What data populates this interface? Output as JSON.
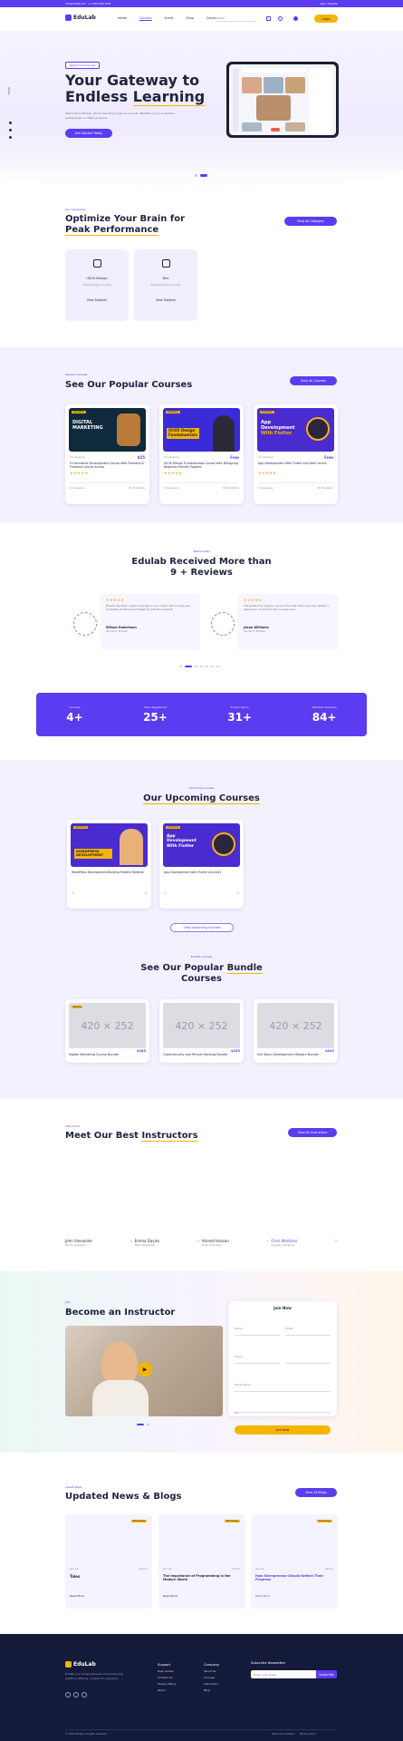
{
  "topbar": {
    "left1": "info@edulab.com",
    "left2": "+1 (555) 000-1234",
    "right": "Login / Register"
  },
  "nav": {
    "logo": "EduLab",
    "items": [
      "Home",
      "Courses",
      "Event",
      "Shop",
      "Contact"
    ],
    "search_placeholder": "Search",
    "cta": "Login"
  },
  "hero": {
    "badge": "Best Online Courses",
    "title1": "Your Gateway to",
    "title2": "Endless",
    "title3": "Learning",
    "desc": "Welcome to Edulab, where learning knows no bounds. Whether you're a student, professional, or lifelong learner.",
    "button": "Get Started Today",
    "side": [
      "Twitter",
      "Facebook",
      "Instagram"
    ]
  },
  "brain": {
    "label": "Our Categories",
    "title1": "Optimize Your Brain for",
    "title2": "Peak Performance",
    "button": "View All Category",
    "cards": [
      {
        "title": "UI/UX Design",
        "sub": "UI/UX Design courses",
        "link": "View Subjects"
      },
      {
        "title": "Dev",
        "sub": "Development courses",
        "link": "View Subjects"
      }
    ]
  },
  "popular": {
    "label": "Popular Courses",
    "title": "See Our Popular Courses",
    "button": "View All Courses",
    "cards": [
      {
        "banner1": "DIGITAL",
        "banner2": "MARKETING",
        "tag": "Bestseller",
        "title": "E-Commerce Development Course With Frontend & Frontend Course Access",
        "price": "$25",
        "meta": "10 Lessons",
        "students": "25 Students"
      },
      {
        "banner1": "UI/UX Design",
        "banner2": "Fundamentals",
        "tag": "Bestseller",
        "title": "UI/UX Design Fundamentals Course With Designing Beginner-Friendly Projects",
        "price": "Free",
        "meta": "10 Lessons",
        "students": "30 Students"
      },
      {
        "banner1": "App",
        "banner2": "Development",
        "banner3": "With Flutter",
        "tag": "Bestseller",
        "title": "App Development With Flutter and Dart Course",
        "price": "Free",
        "meta": "12 Lessons",
        "students": "40 Students"
      }
    ]
  },
  "reviews": {
    "label": "Testimonials",
    "title1": "Edulab Received More than",
    "title2": "9 + Reviews",
    "items": [
      {
        "text": "Edulab has been a game-changer in my career. The courses are incredibly practical and taught by industry experts.",
        "name": "Wilson Robertson",
        "role": "Student, Edulab"
      },
      {
        "text": "The platform is easy to use and the instructors are very helpful. I learned so much from the courses here.",
        "name": "Jason Williams",
        "role": "Student, Edulab"
      }
    ]
  },
  "stats": [
    {
      "label": "Courses",
      "value": "4+"
    },
    {
      "label": "Users Registered",
      "value": "25+"
    },
    {
      "label": "Expert Tutors",
      "value": "31+"
    },
    {
      "label": "Satisfied Students",
      "value": "84+"
    }
  ],
  "upcoming": {
    "label": "Upcoming Courses",
    "title": "Our Upcoming Courses",
    "button": "View Upcoming Courses",
    "cards": [
      {
        "tag": "Upcoming",
        "banner": "WORDPRESS DEVELOPMENT",
        "title": "WordPress Development Building Modern Website",
        "meta": "0",
        "students": "0"
      },
      {
        "tag": "Upcoming",
        "banner": "App Development With Flutter",
        "title": "App Development with Flutter and Dart",
        "meta": "0",
        "students": "0"
      }
    ]
  },
  "bundle": {
    "label": "Bundle Courses",
    "title1": "See Our Popular",
    "title2": "Bundle",
    "title3": "Courses",
    "cards": [
      {
        "tag": "Bundle",
        "img": "420 × 252",
        "title": "Digital Marketing Course Bundle",
        "price": "$243"
      },
      {
        "img": "420 × 252",
        "title": "Cybersecurity and Ethical Hacking Bundle",
        "price": "$243"
      },
      {
        "img": "420 × 252",
        "title": "Full Stack Development Mastery Bundle",
        "price": "$243"
      }
    ]
  },
  "instructors": {
    "label": "Instructors",
    "title1": "Meet Our Best",
    "title2": "Instructors",
    "button": "View All Instructors",
    "list": [
      {
        "name": "John Alexander",
        "role": "UI/UX Designer"
      },
      {
        "name": "Emma Davies",
        "role": "Web Developer"
      },
      {
        "name": "Ahmed Hassan",
        "role": "Data Scientist"
      },
      {
        "name": "Chris Martinez",
        "role": "Graphic Designer"
      }
    ]
  },
  "become": {
    "label": "Join",
    "title": "Become an Instructor",
    "form_title": "Join Now",
    "fields": [
      "Name",
      "Email",
      "Phone",
      "Designation",
      "Bio"
    ],
    "submit": "Join Now"
  },
  "news": {
    "label": "Latest News",
    "title": "Updated News & Blogs",
    "button": "View All Blogs",
    "cards": [
      {
        "tag": "Technology",
        "date": "Jan 12",
        "author": "Admin",
        "title": "Tales",
        "link": "Read More"
      },
      {
        "tag": "Technology",
        "date": "Jan 12",
        "author": "Admin",
        "title": "The Importance of Programming in the Modern World",
        "link": "Read More"
      },
      {
        "tag": "Technology",
        "date": "Jan 12",
        "author": "Admin",
        "title": "How Entrepreneur Should Reflect Their Progress",
        "link": "Read More"
      }
    ]
  },
  "footer": {
    "logo": "EduLab",
    "desc": "Edulab is a comprehensive online learning platform offering courses for everyone.",
    "cols": [
      {
        "title": "Support",
        "items": [
          "Help Center",
          "Contact Us",
          "Privacy Policy",
          "Terms"
        ]
      },
      {
        "title": "Company",
        "items": [
          "About Us",
          "Courses",
          "Instructors",
          "Blog"
        ]
      }
    ],
    "subscribe_title": "Subscribe Newsletter",
    "subscribe_placeholder": "Enter your email",
    "subscribe_button": "Subscribe",
    "copyright": "© 2024 Edulab. All rights reserved.",
    "bottom_links": [
      "Terms & Conditions",
      "Privacy Policy"
    ]
  },
  "colors": {
    "primary": "#5b3cf0",
    "accent": "#f5b400",
    "dark": "#131a3a"
  }
}
